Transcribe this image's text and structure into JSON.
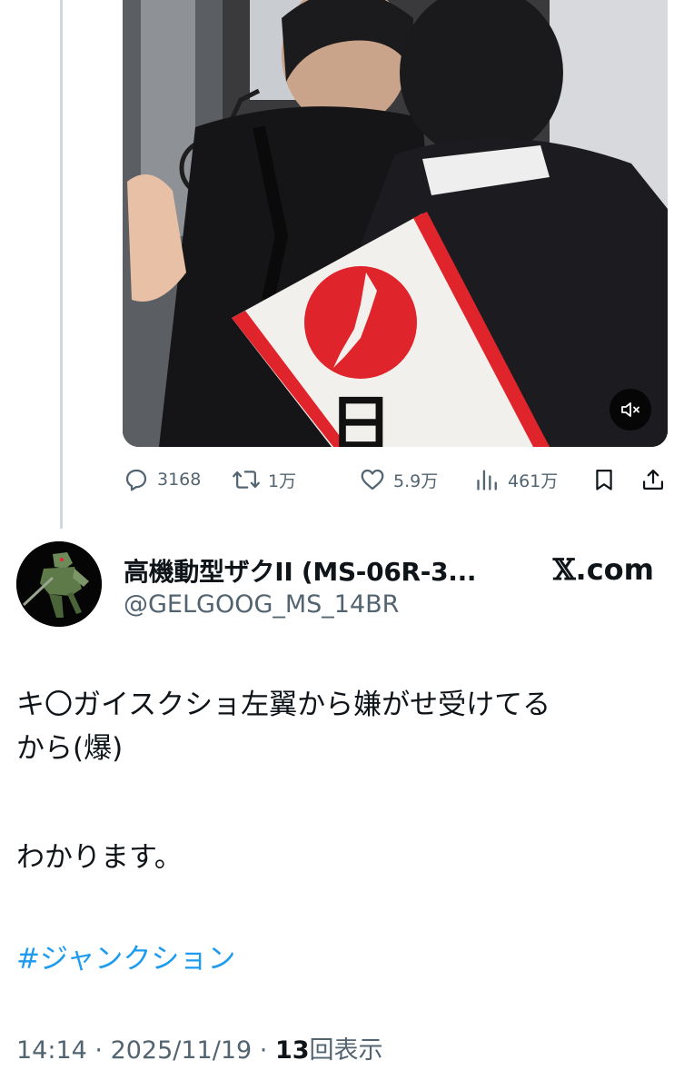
{
  "media": {
    "sash_character": "日"
  },
  "actions": {
    "replies": "3168",
    "reposts": "1万",
    "likes": "5.9万",
    "views": "461万"
  },
  "author": {
    "display_name": "高機動型ザクII (MS-06R-3...",
    "handle": "@GELGOOG_MS_14BR"
  },
  "source": {
    "logo": "𝕏",
    "suffix": ".com"
  },
  "post": {
    "line1": "キ〇ガイスクショ左翼から嫌がせ受けてる",
    "line2": "から(爆)",
    "line3": "わかります。",
    "hashtag": "#ジャンクション"
  },
  "meta": {
    "time": "14:14",
    "sep1": " · ",
    "date": "2025/11/19",
    "sep2": " · ",
    "views_count": "13",
    "views_label": "回表示"
  },
  "colors": {
    "accent": "#1d9bf0",
    "secondary_text": "#536471",
    "primary_text": "#0f1419",
    "sash_red": "#e0242c"
  },
  "icons": [
    "reply-icon",
    "repost-icon",
    "like-icon",
    "views-icon",
    "bookmark-icon",
    "share-icon",
    "mute-icon"
  ]
}
